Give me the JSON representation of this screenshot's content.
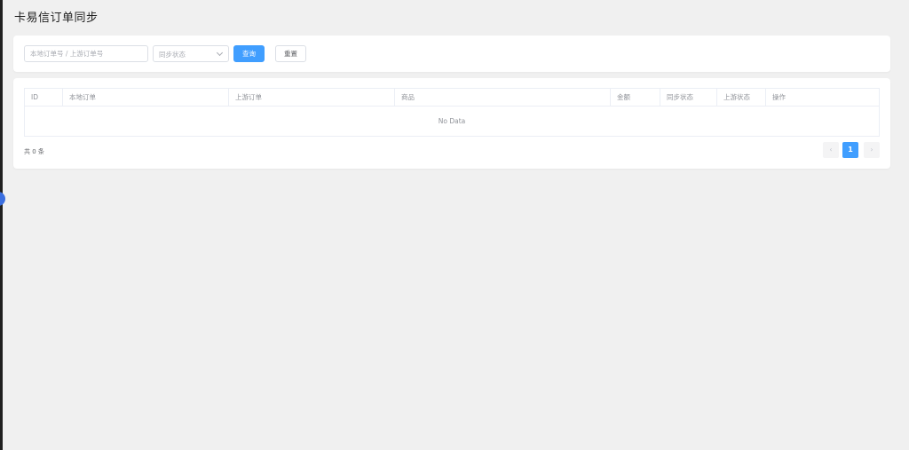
{
  "page": {
    "title": "卡易信订单同步"
  },
  "filters": {
    "order_input_placeholder": "本地订单号 / 上游订单号",
    "sync_status_placeholder": "同步状态",
    "query_label": "查询",
    "reset_label": "重置"
  },
  "table": {
    "columns": [
      "ID",
      "本地订单",
      "上游订单",
      "商品",
      "金额",
      "同步状态",
      "上游状态",
      "操作"
    ],
    "rows": [],
    "empty_text": "No Data"
  },
  "pagination": {
    "total_text": "共 0 条",
    "current_page": "1",
    "prev_symbol": "‹",
    "next_symbol": "›"
  },
  "colors": {
    "primary": "#409eff",
    "background": "#f0f0f0",
    "card": "#ffffff"
  }
}
